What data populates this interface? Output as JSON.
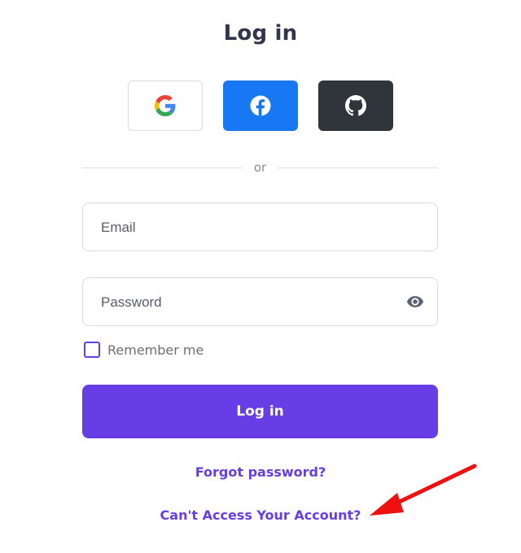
{
  "title": "Log in",
  "social": {
    "google_label": "Google",
    "facebook_label": "Facebook",
    "github_label": "GitHub"
  },
  "divider": "or",
  "form": {
    "email_placeholder": "Email",
    "password_placeholder": "Password",
    "remember_label": "Remember me",
    "login_button": "Log in"
  },
  "links": {
    "forgot_password": "Forgot password?",
    "cant_access": "Can't Access Your Account?"
  },
  "colors": {
    "accent": "#673de6",
    "facebook": "#1877f2",
    "github": "#2f353b",
    "annotation_arrow": "#ee1111"
  },
  "icons": {
    "google": "google-icon",
    "facebook": "facebook-icon",
    "github": "github-icon",
    "eye": "eye-icon",
    "annotation": "red-arrow-icon"
  }
}
